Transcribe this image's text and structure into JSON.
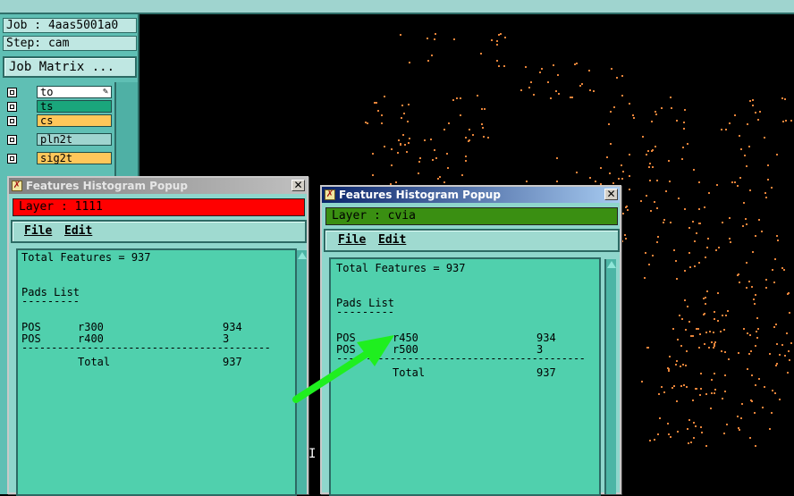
{
  "left_panel": {
    "job_line": "Job : 4aas5001a0",
    "step_line": "Step: cam",
    "job_matrix_label": "Job Matrix ...",
    "layers": [
      {
        "name": "to",
        "color": "#ffffff"
      },
      {
        "name": "ts",
        "color": "#1aa67c"
      },
      {
        "name": "cs",
        "color": "#ffc75a"
      },
      {
        "name": "pln2t",
        "color": "#9fd4cf"
      },
      {
        "name": "sig2t",
        "color": "#ffc75a"
      }
    ]
  },
  "popups": [
    {
      "title": "Features Histogram Popup",
      "active": false,
      "layer_label": "Layer :  1111",
      "layer_color": "#ff0000",
      "menu": {
        "file": "File",
        "edit": "Edit"
      },
      "report": {
        "total": "Total Features = 937",
        "heading": "Pads List",
        "heading_rule": "---------",
        "rows": [
          {
            "type": "POS",
            "symbol": "r300",
            "count": "934"
          },
          {
            "type": "POS",
            "symbol": "r400",
            "count": "3"
          }
        ],
        "rule": "------------------------------------------",
        "total_label": "Total",
        "total_value": "937"
      }
    },
    {
      "title": "Features Histogram Popup",
      "active": true,
      "layer_label": "Layer :  cvia",
      "layer_color": "#3a8f12",
      "menu": {
        "file": "File",
        "edit": "Edit"
      },
      "report": {
        "total": "Total Features = 937",
        "heading": "Pads List",
        "heading_rule": "---------",
        "rows": [
          {
            "type": "POS",
            "symbol": "r450",
            "count": "934"
          },
          {
            "type": "POS",
            "symbol": "r500",
            "count": "3"
          }
        ],
        "rule": "------------------------------------------",
        "total_label": "Total",
        "total_value": "937"
      }
    }
  ],
  "colors": {
    "canvas_bg": "#000000",
    "feature_dots": "#e8843a",
    "annotation_arrow": "#1fef1f",
    "panel_teal": "#5fbfb4"
  },
  "close_glyph": "✕"
}
